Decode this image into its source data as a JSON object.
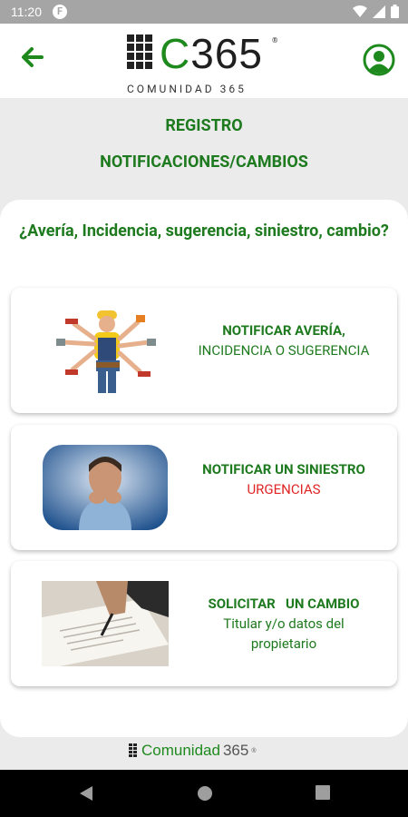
{
  "status": {
    "time": "11:20",
    "app_icon": "F"
  },
  "header": {
    "logo_main": "365",
    "logo_letter": "C",
    "logo_sub": "COMUNIDAD 365",
    "registered": "®"
  },
  "titles": {
    "line1": "REGISTRO",
    "line2": "NOTIFICACIONES/CAMBIOS"
  },
  "question": "¿Avería, Incidencia, sugerencia, siniestro, cambio?",
  "cards": [
    {
      "title": "NOTIFICAR AVERÍA,",
      "subtitle": "INCIDENCIA O SUGERENCIA"
    },
    {
      "title": "NOTIFICAR UN SINIESTRO",
      "subtitle": "URGENCIAS"
    },
    {
      "title": "SOLICITAR   UN CAMBIO",
      "subtitle": "Titular y/o datos del propietario"
    }
  ],
  "footer": {
    "word1": "Comunidad",
    "word2": "365",
    "mark": "®"
  },
  "colors": {
    "brand_green": "#1e7a1e",
    "urgent_red": "#e02424"
  }
}
